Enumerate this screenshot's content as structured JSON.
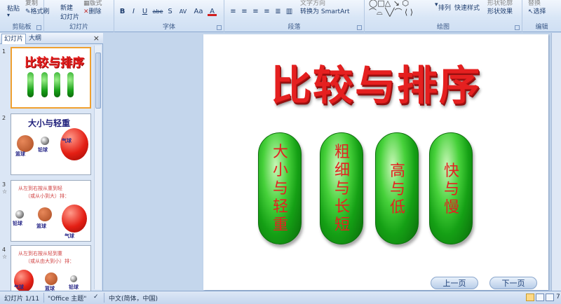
{
  "ribbon": {
    "clipboard": {
      "paste": "粘贴",
      "copy": "复制",
      "format_painter": "格式刷",
      "label": "剪贴板"
    },
    "slides": {
      "new_slide_line1": "新建",
      "new_slide_line2": "幻灯片",
      "layout": "版式",
      "delete": "删除",
      "label": "幻灯片"
    },
    "font": {
      "label": "字体",
      "bold": "B",
      "italic": "I",
      "underline": "U",
      "strike": "abe",
      "shadow": "S",
      "spacing": "AV",
      "case": "Aa",
      "color": "A"
    },
    "paragraph": {
      "label": "段落",
      "smartart": "转换为 SmartArt",
      "text_direction": "文字方向"
    },
    "drawing": {
      "label": "绘图",
      "arrange": "排列",
      "quick_styles": "快速样式",
      "shape_effects": "形状效果",
      "shape_outline": "形状轮廓"
    },
    "editing": {
      "label": "编辑",
      "select": "选择",
      "replace": "替换"
    }
  },
  "pane": {
    "tab_slides": "幻灯片",
    "tab_outline": "大纲",
    "close": "×",
    "thumbs": [
      {
        "num": "1",
        "title": "比较与排序"
      },
      {
        "num": "2",
        "title": "大小与轻重",
        "labels": [
          "篮球",
          "铅球",
          "气球"
        ]
      },
      {
        "num": "3",
        "title": "从左到右按从重到轻",
        "subtitle": "（或从小到大）排：",
        "labels": [
          "铅球",
          "篮球",
          "气球"
        ]
      },
      {
        "num": "4",
        "title": "从左到右按从轻到重",
        "subtitle": "（或从由大到小）排：",
        "labels": [
          "气球",
          "篮球",
          "铅球"
        ]
      }
    ]
  },
  "slide": {
    "title": "比较与排序",
    "pills": [
      {
        "text": "大小与轻重"
      },
      {
        "text": "粗细与长短"
      },
      {
        "text": "高与低"
      },
      {
        "text": "快与慢"
      }
    ],
    "prev": "上一页",
    "next": "下一页"
  },
  "status": {
    "slide_count": "幻灯片 1/11",
    "theme": "\"Office 主题\"",
    "language": "中文(简体，中国)",
    "zoom": "7"
  },
  "colors": {
    "title_red": "#e52020",
    "pill_green": "#15a015",
    "ribbon_bg": "#d9e6f6"
  }
}
